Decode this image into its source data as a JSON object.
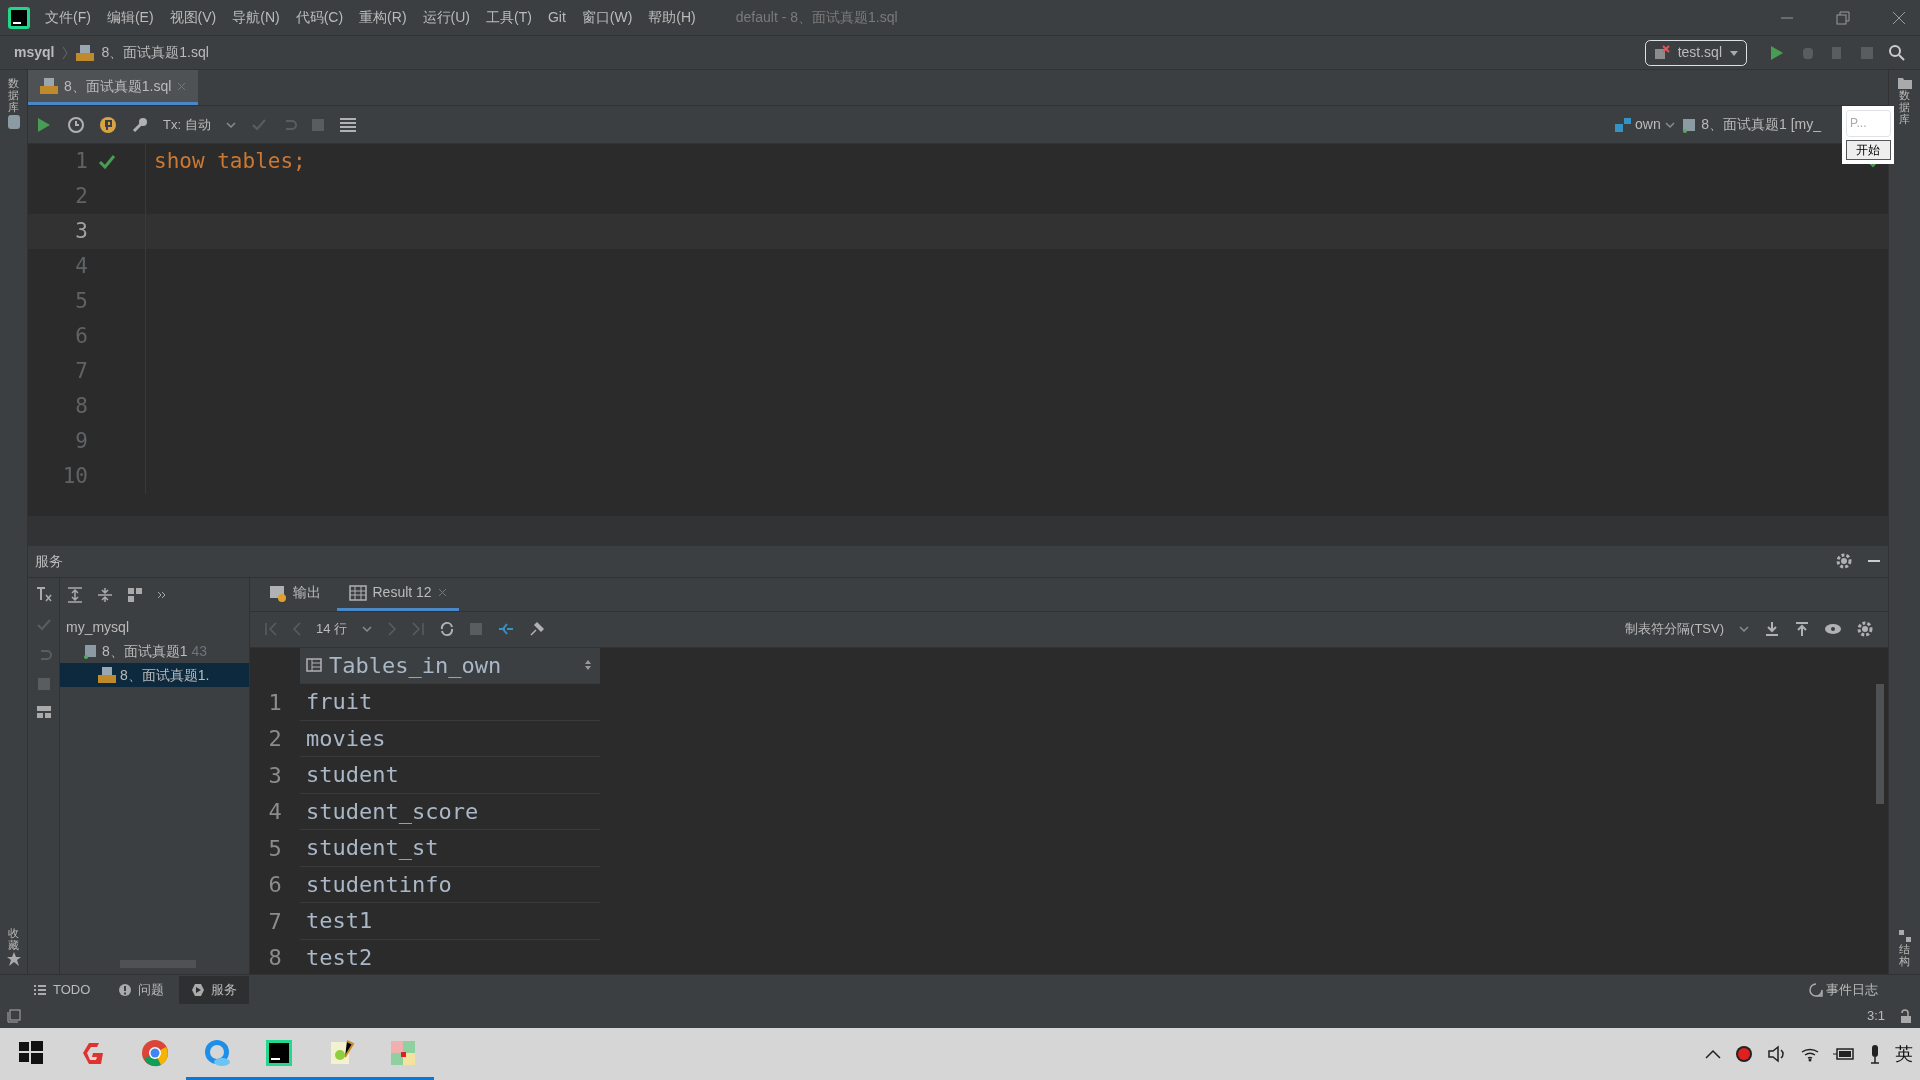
{
  "window": {
    "title": "default - 8、面试真题1.sql"
  },
  "menu": [
    "文件(F)",
    "编辑(E)",
    "视图(V)",
    "导航(N)",
    "代码(C)",
    "重构(R)",
    "运行(U)",
    "工具(T)",
    "Git",
    "窗口(W)",
    "帮助(H)"
  ],
  "breadcrumb": [
    "msyql",
    "8、面试真题1.sql"
  ],
  "run_config": {
    "label": "test.sql"
  },
  "editor_tabs": [
    {
      "label": "8、面试真题1.sql",
      "selected": true
    }
  ],
  "editor_toolbar": {
    "tx": "Tx: 自动",
    "schema": "own",
    "session": "8、面试真题1 [my_"
  },
  "popup": {
    "field": "P...",
    "button": "开始"
  },
  "editor": {
    "lines": [
      {
        "number": "1",
        "code": "show tables;",
        "ok": true,
        "current": false
      },
      {
        "number": "2",
        "ok": false,
        "current": false
      },
      {
        "number": "3",
        "ok": false,
        "current": true
      },
      {
        "number": "4",
        "ok": false,
        "current": false
      },
      {
        "number": "5",
        "ok": false,
        "current": false
      },
      {
        "number": "6",
        "ok": false,
        "current": false
      },
      {
        "number": "7",
        "ok": false,
        "current": false
      },
      {
        "number": "8",
        "ok": false,
        "current": false
      },
      {
        "number": "9",
        "ok": false,
        "current": false
      },
      {
        "number": "10",
        "ok": false,
        "current": false
      }
    ]
  },
  "left_strip": [
    "数据库",
    "收藏"
  ],
  "right_strip": [
    "数据库",
    "结构"
  ],
  "services": {
    "title": "服务",
    "tree": [
      {
        "label": "my_mysql",
        "selected": false,
        "children": [
          {
            "label": "8、面试真题1",
            "note": "43",
            "selected": false,
            "children": [
              {
                "label": "8、面试真题1.",
                "selected": true
              }
            ]
          }
        ]
      }
    ],
    "tabs": [
      {
        "label": "输出",
        "selected": false
      },
      {
        "label": "Result 12",
        "selected": true
      }
    ],
    "row_count": "14 行",
    "export_format": "制表符分隔(TSV)",
    "grid": {
      "columns": [
        "",
        "Tables_in_own"
      ],
      "rows": [
        [
          "1",
          "fruit"
        ],
        [
          "2",
          "movies"
        ],
        [
          "3",
          "student"
        ],
        [
          "4",
          "student_score"
        ],
        [
          "5",
          "student_st"
        ],
        [
          "6",
          "studentinfo"
        ],
        [
          "7",
          "test1"
        ],
        [
          "8",
          "test2"
        ]
      ]
    }
  },
  "bottom_tabs": [
    {
      "label": "TODO",
      "selected": false
    },
    {
      "label": "问题",
      "selected": false
    },
    {
      "label": "服务",
      "selected": true
    }
  ],
  "status_bar": {
    "event_log": "事件日志",
    "position": "3:1"
  },
  "taskbar": {
    "items": [
      {
        "kind": "start",
        "running": false
      },
      {
        "kind": "red-g",
        "running": false
      },
      {
        "kind": "chrome",
        "running": false
      },
      {
        "kind": "browser",
        "running": true
      },
      {
        "kind": "datagrip",
        "running": true
      },
      {
        "kind": "notepad",
        "running": true
      },
      {
        "kind": "paint",
        "running": true
      }
    ],
    "language": "英"
  }
}
